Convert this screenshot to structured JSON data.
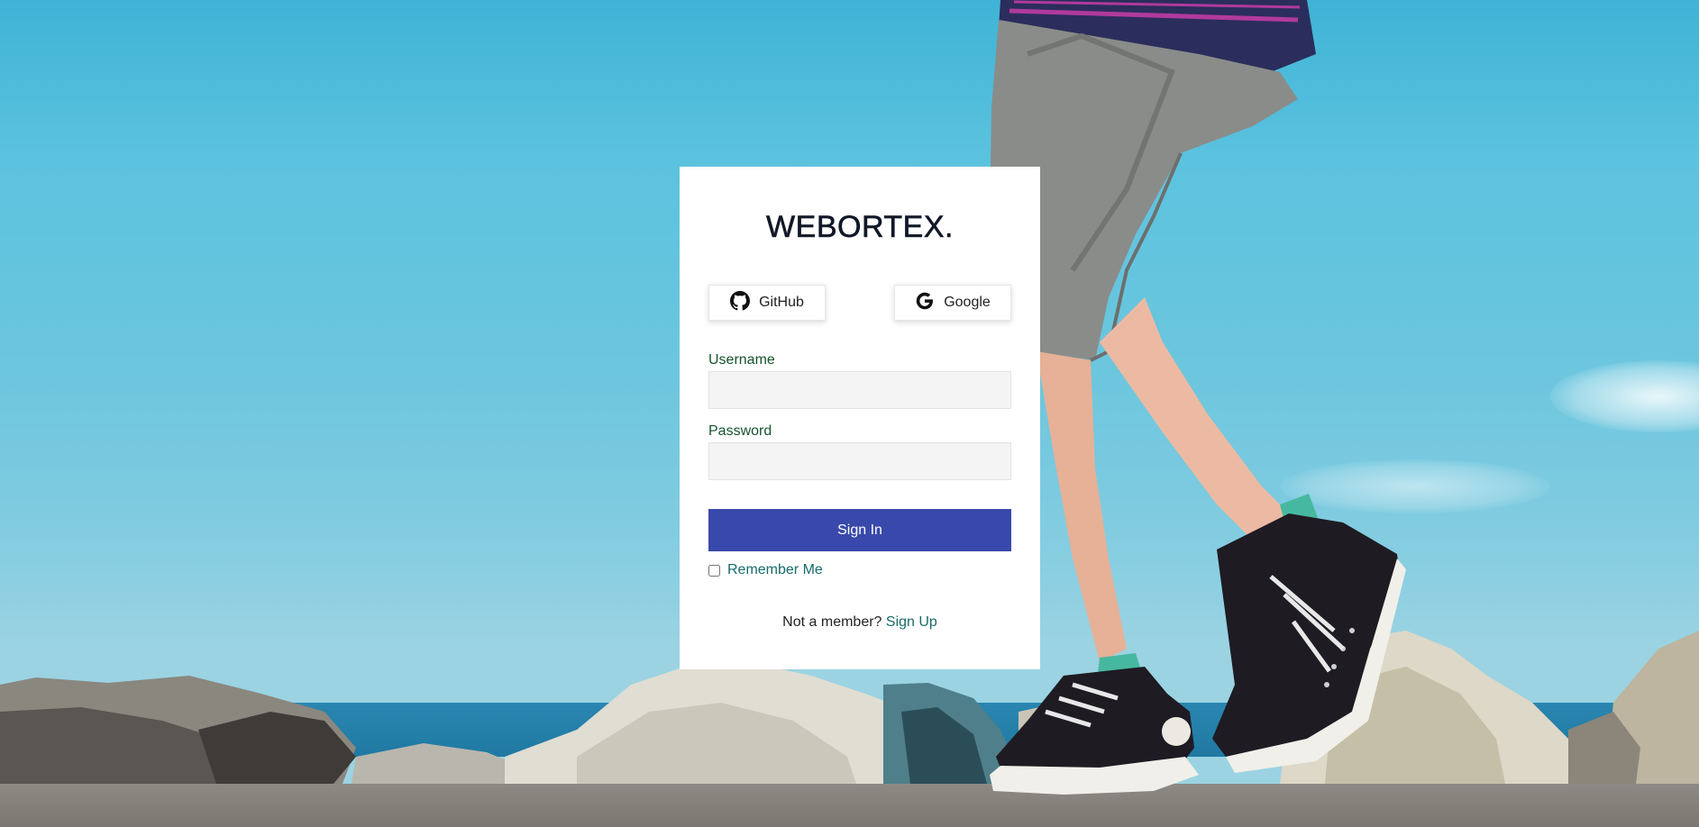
{
  "brand": {
    "title": "WEBORTEX."
  },
  "social": {
    "github": {
      "label": "GitHub",
      "icon": "github-icon"
    },
    "google": {
      "label": "Google",
      "icon": "google-icon"
    }
  },
  "form": {
    "username": {
      "label": "Username",
      "value": "",
      "placeholder": ""
    },
    "password": {
      "label": "Password",
      "value": "",
      "placeholder": ""
    },
    "submit_label": "Sign In",
    "remember": {
      "label": "Remember Me",
      "checked": false
    }
  },
  "signup": {
    "prompt": "Not a member?",
    "link_label": "Sign Up"
  },
  "colors": {
    "primary": "#3949ab",
    "label_green": "#14532d",
    "link_teal": "#1b6b6b",
    "sky": "#5cc3df"
  }
}
